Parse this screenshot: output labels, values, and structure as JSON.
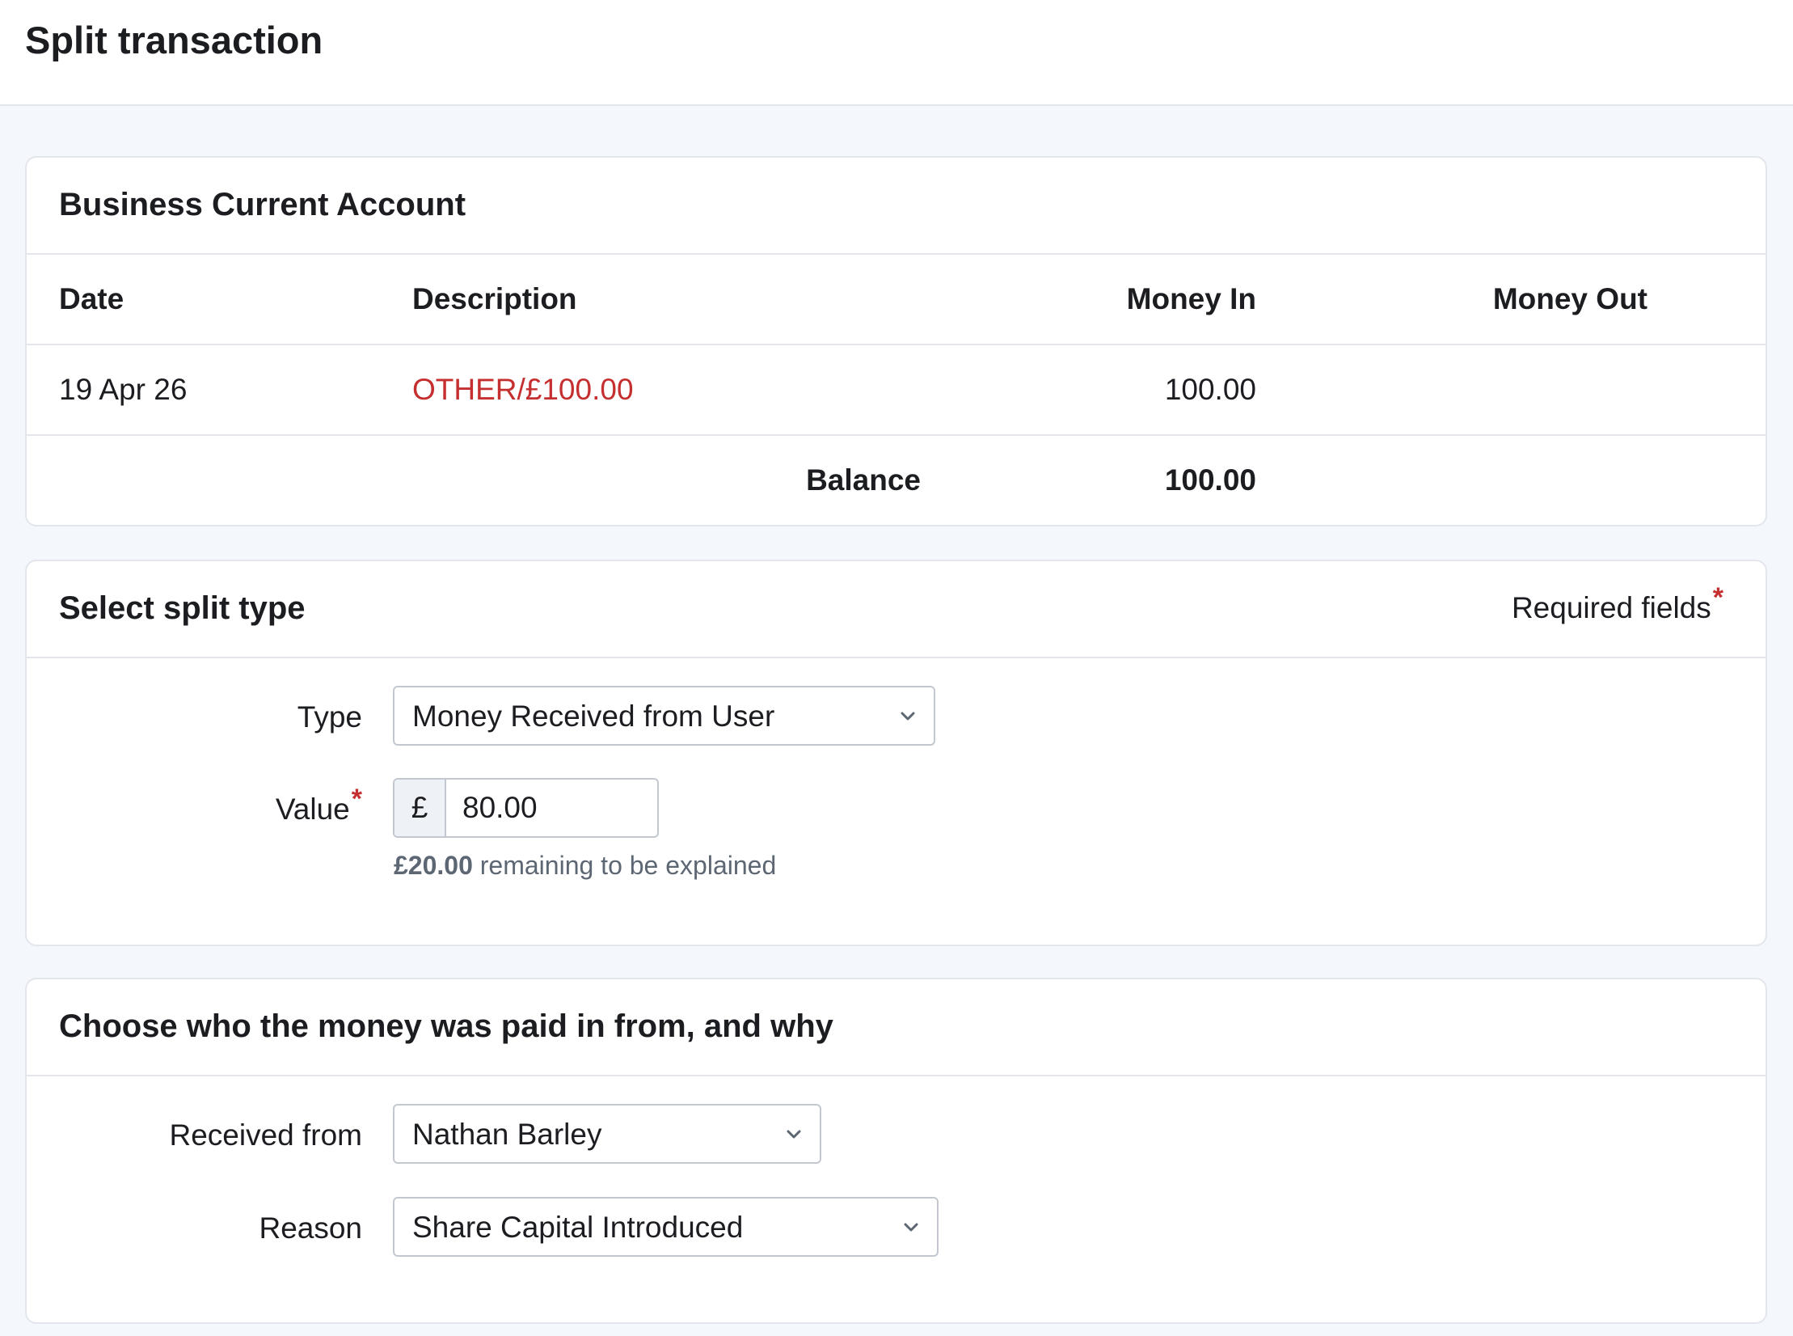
{
  "page": {
    "title": "Split transaction"
  },
  "account": {
    "title": "Business Current Account",
    "columns": {
      "date": "Date",
      "description": "Description",
      "money_in": "Money In",
      "money_out": "Money Out"
    },
    "transaction": {
      "date": "19 Apr 26",
      "description": "OTHER/£100.00",
      "money_in": "100.00",
      "money_out": ""
    },
    "balance": {
      "label": "Balance",
      "value": "100.00"
    }
  },
  "split": {
    "title": "Select split type",
    "required_note": "Required fields",
    "required_marker": "*",
    "type_label": "Type",
    "type_value": "Money Received from User",
    "value_label": "Value",
    "currency_prefix": "£",
    "value": "80.00",
    "remaining_amount": "£20.00",
    "remaining_text": "remaining to be explained"
  },
  "who": {
    "title": "Choose who the money was paid in from, and why",
    "received_from_label": "Received from",
    "received_from_value": "Nathan Barley",
    "reason_label": "Reason",
    "reason_value": "Share Capital Introduced"
  },
  "colors": {
    "accent_red": "#c52f2f",
    "background": "#f4f7fc",
    "border": "#e3e6ec"
  },
  "icons": {
    "dropdown": "chevron-down-icon"
  }
}
